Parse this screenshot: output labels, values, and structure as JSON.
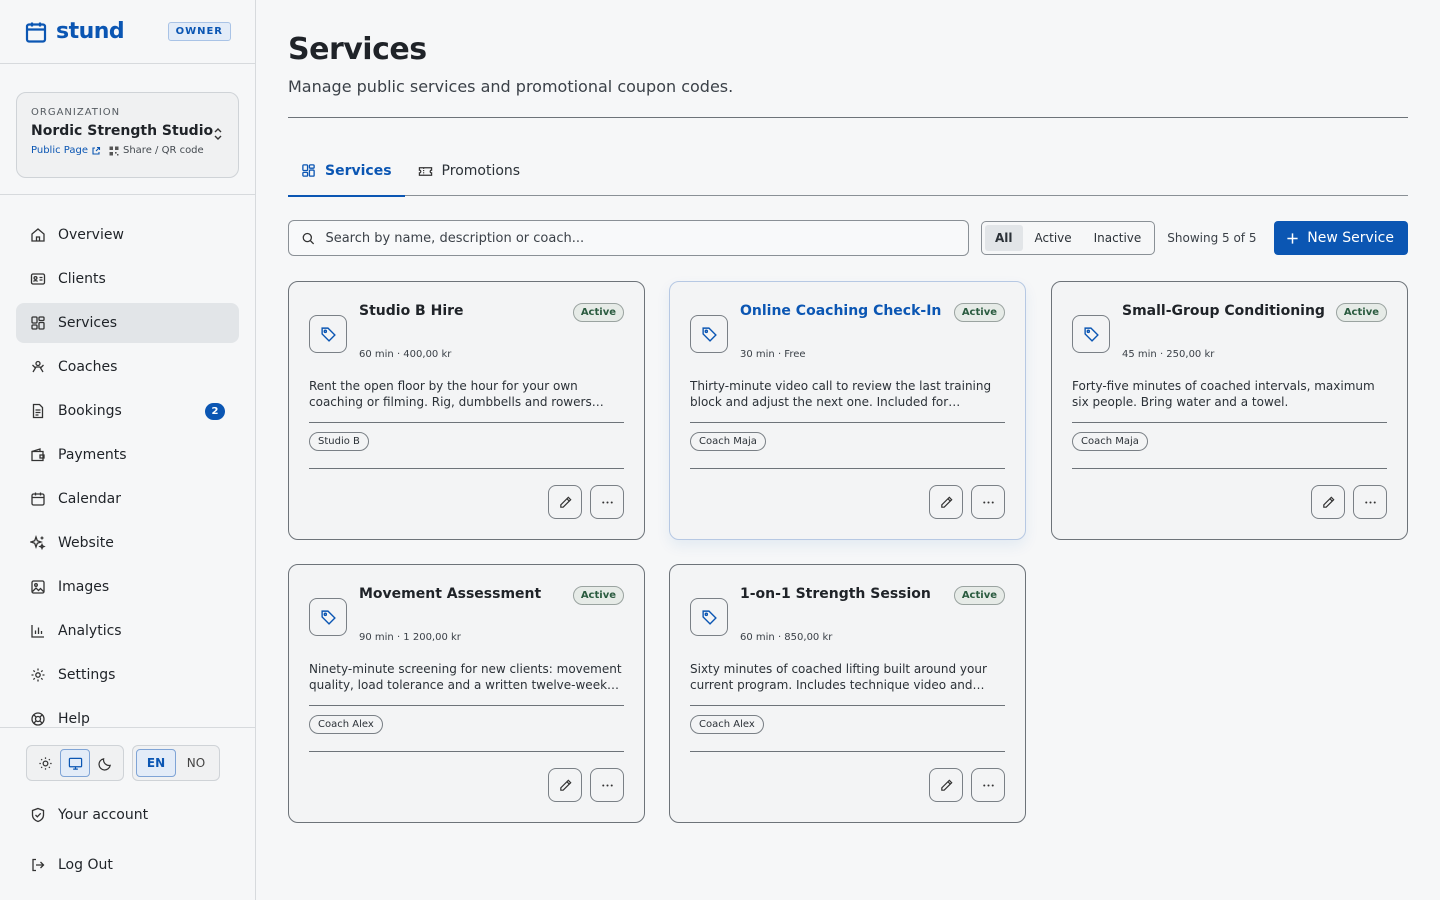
{
  "brand": {
    "name": "stund",
    "role_badge": "OWNER"
  },
  "org": {
    "label": "ORGANIZATION",
    "name": "Nordic Strength Studio",
    "public_page": "Public Page",
    "share": "Share / QR code"
  },
  "nav": [
    {
      "label": "Overview",
      "icon": "home-icon"
    },
    {
      "label": "Clients",
      "icon": "id-card-icon"
    },
    {
      "label": "Services",
      "icon": "grid-icon",
      "active": true
    },
    {
      "label": "Coaches",
      "icon": "coach-icon"
    },
    {
      "label": "Bookings",
      "icon": "document-icon",
      "badge": "2"
    },
    {
      "label": "Payments",
      "icon": "wallet-icon"
    },
    {
      "label": "Calendar",
      "icon": "calendar-icon"
    },
    {
      "label": "Website",
      "icon": "sparkle-icon"
    },
    {
      "label": "Images",
      "icon": "image-icon"
    },
    {
      "label": "Analytics",
      "icon": "bar-chart-icon"
    },
    {
      "label": "Settings",
      "icon": "gear-icon"
    },
    {
      "label": "Help",
      "icon": "lifebuoy-icon"
    }
  ],
  "theme_toggle": {
    "selected": "system"
  },
  "language": {
    "options": [
      "EN",
      "NO"
    ],
    "selected": "EN"
  },
  "footer": {
    "account": "Your account",
    "logout": "Log Out"
  },
  "page": {
    "title": "Services",
    "subtitle": "Manage public services and promotional coupon codes."
  },
  "tabs": [
    {
      "label": "Services",
      "active": true
    },
    {
      "label": "Promotions"
    }
  ],
  "search": {
    "placeholder": "Search by name, description or coach..."
  },
  "filter": {
    "options": [
      "All",
      "Active",
      "Inactive"
    ],
    "selected": "All"
  },
  "showing": "Showing 5 of 5",
  "new_button": "New Service",
  "colors": {
    "accent": "#0b56b3",
    "status_active": "#2a5b3f"
  },
  "services": [
    {
      "title": "Studio B Hire",
      "status": "Active",
      "meta": "60 min · 400,00 kr",
      "description": "Rent the open floor by the hour for your own coaching or filming. Rig, dumbbells and rowers included.",
      "tag": "Studio B"
    },
    {
      "title": "Online Coaching Check-In",
      "status": "Active",
      "meta": "30 min · Free",
      "description": "Thirty-minute video call to review the last training block and adjust the next one. Included for programme clients.",
      "tag": "Coach Maja"
    },
    {
      "title": "Small-Group Conditioning",
      "status": "Active",
      "meta": "45 min · 250,00 kr",
      "description": "Forty-five minutes of coached intervals, maximum six people. Bring water and a towel.",
      "tag": "Coach Maja"
    },
    {
      "title": "Movement Assessment",
      "status": "Active",
      "meta": "90 min · 1 200,00 kr",
      "description": "Ninety-minute screening for new clients: movement quality, load tolerance and a written twelve-week plan.",
      "tag": "Coach Alex"
    },
    {
      "title": "1-on-1 Strength Session",
      "status": "Active",
      "meta": "60 min · 850,00 kr",
      "description": "Sixty minutes of coached lifting built around your current program. Includes technique video and notes afterwards.",
      "tag": "Coach Alex"
    }
  ]
}
